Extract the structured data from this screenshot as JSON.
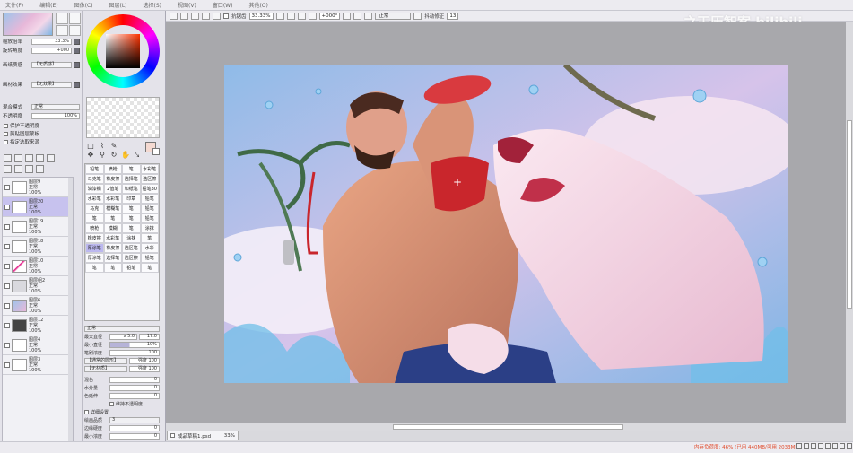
{
  "menu": [
    "文件(F)",
    "编辑(E)",
    "图像(C)",
    "图层(L)",
    "选择(S)",
    "视图(V)",
    "窗口(W)",
    "其他(O)"
  ],
  "navigator": {
    "zoom_label": "缩放倍率",
    "zoom_value": "33.3%",
    "rotate_label": "旋转角度",
    "rotate_value": "+000"
  },
  "layer_props": {
    "texture_label": "画纸质感",
    "texture_value": "【无质感】",
    "effect_label": "画材效果",
    "effect_value": "【无效果】",
    "blend_label": "混合模式",
    "blend_value": "正常",
    "opacity_label": "不透明度",
    "opacity_value": "100%",
    "check1": "保护不透明度",
    "check2": "剪贴图层蒙板",
    "check3": "指定选取来源"
  },
  "layers": [
    {
      "name": "图层9",
      "mode": "正常",
      "opacity": "100%"
    },
    {
      "name": "图层20",
      "mode": "正常",
      "opacity": "100%",
      "selected": true
    },
    {
      "name": "图层19",
      "mode": "正常",
      "opacity": "100%"
    },
    {
      "name": "图层18",
      "mode": "正常",
      "opacity": "100%"
    },
    {
      "name": "图层10",
      "mode": "正常",
      "opacity": "100%"
    },
    {
      "name": "图层组2",
      "mode": "正常",
      "opacity": "100%"
    },
    {
      "name": "图层6",
      "mode": "正常",
      "opacity": "100%"
    },
    {
      "name": "图层12",
      "mode": "正常",
      "opacity": "100%"
    },
    {
      "name": "图层4",
      "mode": "正常",
      "opacity": "100%"
    },
    {
      "name": "图层3",
      "mode": "正常",
      "opacity": "100%"
    }
  ],
  "brush_tools": [
    "铅笔",
    "喷枪",
    "笔",
    "水彩笔",
    "马克笔",
    "橡皮擦",
    "选择笔",
    "选区擦",
    "油漆桶",
    "2值笔",
    "和纸笔",
    "铅笔30",
    "水彩笔",
    "水彩笔",
    "印章",
    "铅笔",
    "马克",
    "模糊笔",
    "笔",
    "铅笔",
    "笔",
    "笔",
    "笔",
    "铅笔",
    "喷枪",
    "模糊",
    "笔",
    "涂抹",
    "橡皮擦",
    "水彩笔",
    "涂抹",
    "笔",
    "厚涂笔",
    "橡皮擦",
    "选区笔",
    "水彩",
    "厚涂笔",
    "选择笔",
    "选区擦",
    "铅笔",
    "笔",
    "笔",
    "铅笔",
    "笔"
  ],
  "brush_props": {
    "blend": "正常",
    "max_size_label": "最大直径",
    "max_size_value": "x 5.0",
    "max_size_num": "17.0",
    "min_size_label": "最小直径",
    "min_size_value": "10%",
    "density_label": "笔刷浓度",
    "density_value": "100",
    "shape_value": "【通常的圆形】",
    "shape_num": "强度 100",
    "texture_value": "【无材质】",
    "texture_num": "强度 100",
    "mix_label": "混色",
    "mix_value": "0",
    "water_label": "水分量",
    "water_value": "0",
    "extend_label": "色延伸",
    "extend_value": "0",
    "keep_opacity": "维持不透明度",
    "detail_label": "详细设置",
    "quality_label": "绘画品质",
    "quality_value": "3",
    "hardness_label": "边缘硬度",
    "hardness_value": "0",
    "min_density_label": "最小浓度",
    "min_density_value": "0"
  },
  "toolbar": {
    "antialias": "抗锯齿",
    "zoom": "33.33%",
    "rotate": "+000°",
    "mode": "正常",
    "stabilizer_label": "抖动修正",
    "stabilizer_value": "13"
  },
  "watermark": "之王历智案 bilibili",
  "file_tab": {
    "name": "成品草稿1.psd",
    "zoom": "33%"
  },
  "status": {
    "memory": "内存负荷度: 46% (已用 440MB/可用 2033MB)"
  },
  "colors": {
    "selected_layer": "#c7c2ee",
    "memory_text": "#e04a2a",
    "fg_color": "#f4d9d1"
  }
}
